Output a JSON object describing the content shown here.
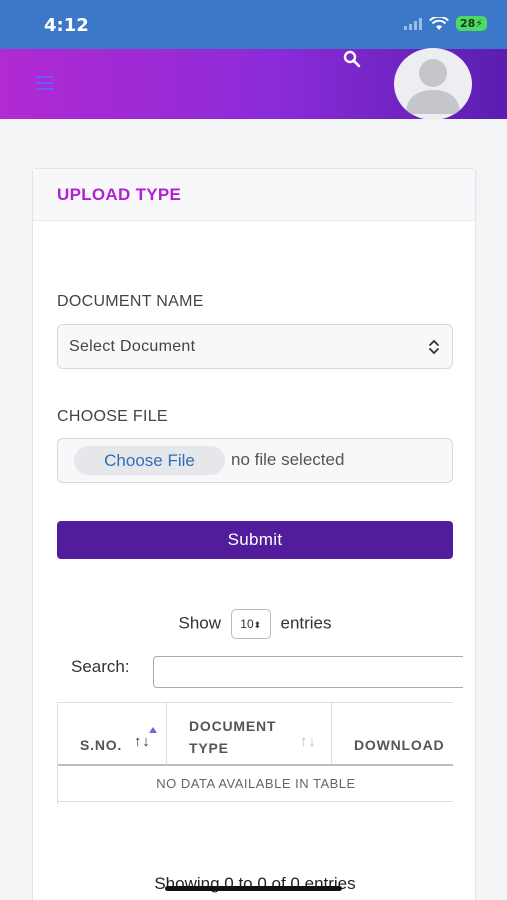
{
  "status_bar": {
    "time": "4:12",
    "battery": "28"
  },
  "header": {
    "menu_icon": "hamburger-icon",
    "search_icon": "search-icon",
    "avatar_icon": "user-avatar"
  },
  "card": {
    "title": "UPLOAD TYPE",
    "document_name_label": "DOCUMENT NAME",
    "document_select_value": "Select Document",
    "choose_file_label": "CHOOSE FILE",
    "choose_file_button": "Choose File",
    "file_status": "no file selected",
    "submit_label": "Submit",
    "show_label": "Show",
    "entries_value": "10",
    "entries_label": "entries",
    "search_label": "Search:",
    "table": {
      "columns": [
        "S.NO.",
        "DOCUMENT TYPE",
        "DOWNLOAD"
      ],
      "empty_message": "NO DATA AVAILABLE IN TABLE"
    },
    "showing_text": "Showing 0 to 0 of 0 entries"
  },
  "colors": {
    "status_bar": "#3b78c8",
    "header_start": "#b22ad2",
    "header_end": "#5a1eb0",
    "title": "#b21fd1",
    "submit": "#521d9d"
  }
}
